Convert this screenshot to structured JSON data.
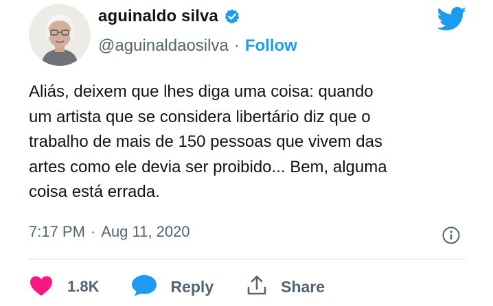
{
  "author": {
    "display_name": "aguinaldo silva",
    "handle": "@aguinaldaosilva",
    "separator": "·",
    "follow_label": "Follow"
  },
  "tweet": {
    "text": "Aliás, deixem que lhes diga uma coisa: quando\num artista que se considera libertário diz que o\ntrabalho de mais de 150 pessoas que vivem das\nartes como ele devia ser proibido... Bem, alguma\ncoisa está errada."
  },
  "meta": {
    "time": "7:17 PM",
    "separator": "·",
    "date": "Aug 11, 2020"
  },
  "actions": {
    "likes_count": "1.8K",
    "reply_label": "Reply",
    "share_label": "Share"
  },
  "colors": {
    "accent": "#1d9bf0",
    "like": "#f91880",
    "secondary_text": "#536471"
  },
  "icons": [
    "verified-badge-icon",
    "twitter-logo-icon",
    "info-icon",
    "heart-icon",
    "reply-bubble-icon",
    "share-icon"
  ]
}
